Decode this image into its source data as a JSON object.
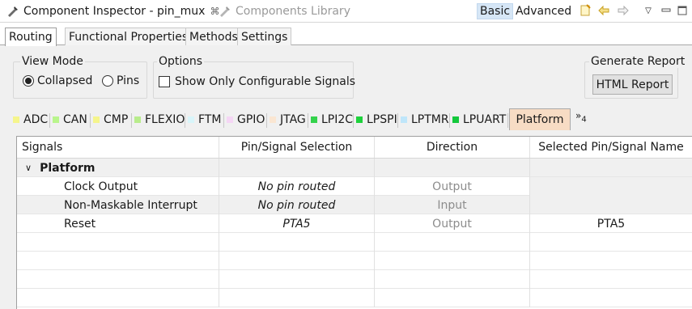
{
  "viewbar": {
    "active_tab": "Component Inspector - pin_mux",
    "inactive_tab": "Components Library",
    "close_glyph": "⌘",
    "basic_label": "Basic",
    "advanced_label": "Advanced",
    "icons": [
      "note-icon",
      "arrow-left-icon",
      "arrow-right-icon",
      "view-menu-icon",
      "minimize-icon",
      "maximize-icon"
    ]
  },
  "subtabs": [
    "Routing",
    "Functional Properties",
    "Methods",
    "Settings"
  ],
  "view_mode": {
    "title": "View Mode",
    "collapsed_label": "Collapsed",
    "pins_label": "Pins",
    "selected": "Collapsed"
  },
  "options": {
    "title": "Options",
    "show_only_label": "Show Only Configurable Signals",
    "checked": false
  },
  "report": {
    "title": "Generate Report",
    "button_label": "HTML Report"
  },
  "peripherals": [
    {
      "label": "ADC",
      "color": "#f5f58c"
    },
    {
      "label": "CAN",
      "color": "#b9f58c"
    },
    {
      "label": "CMP",
      "color": "#f5f58c"
    },
    {
      "label": "FLEXIO",
      "color": "#b8ec8c"
    },
    {
      "label": "FTM",
      "color": "#d8f5fa"
    },
    {
      "label": "GPIO",
      "color": "#f5d6f5"
    },
    {
      "label": "JTAG",
      "color": "#fae6d2"
    },
    {
      "label": "LPI2C",
      "color": "#34d24c"
    },
    {
      "label": "LPSPI",
      "color": "#1ed23c"
    },
    {
      "label": "LPTMR",
      "color": "#bfe6fa"
    },
    {
      "label": "LPUART",
      "color": "#14c83c"
    }
  ],
  "active_peripheral": "Platform",
  "overflow": {
    "glyph": "»",
    "count": "4"
  },
  "table": {
    "headers": [
      "Signals",
      "Pin/Signal Selection",
      "Direction",
      "Selected Pin/Signal Name"
    ],
    "group": {
      "expander": "∨",
      "label": "Platform"
    },
    "rows": [
      {
        "signal": "Clock Output",
        "selection": "No pin routed",
        "direction": "Output",
        "name": ""
      },
      {
        "signal": "Non-Maskable Interrupt",
        "selection": "No pin routed",
        "direction": "Input",
        "name": ""
      },
      {
        "signal": "Reset",
        "selection": "PTA5",
        "direction": "Output",
        "name": "PTA5"
      }
    ]
  }
}
